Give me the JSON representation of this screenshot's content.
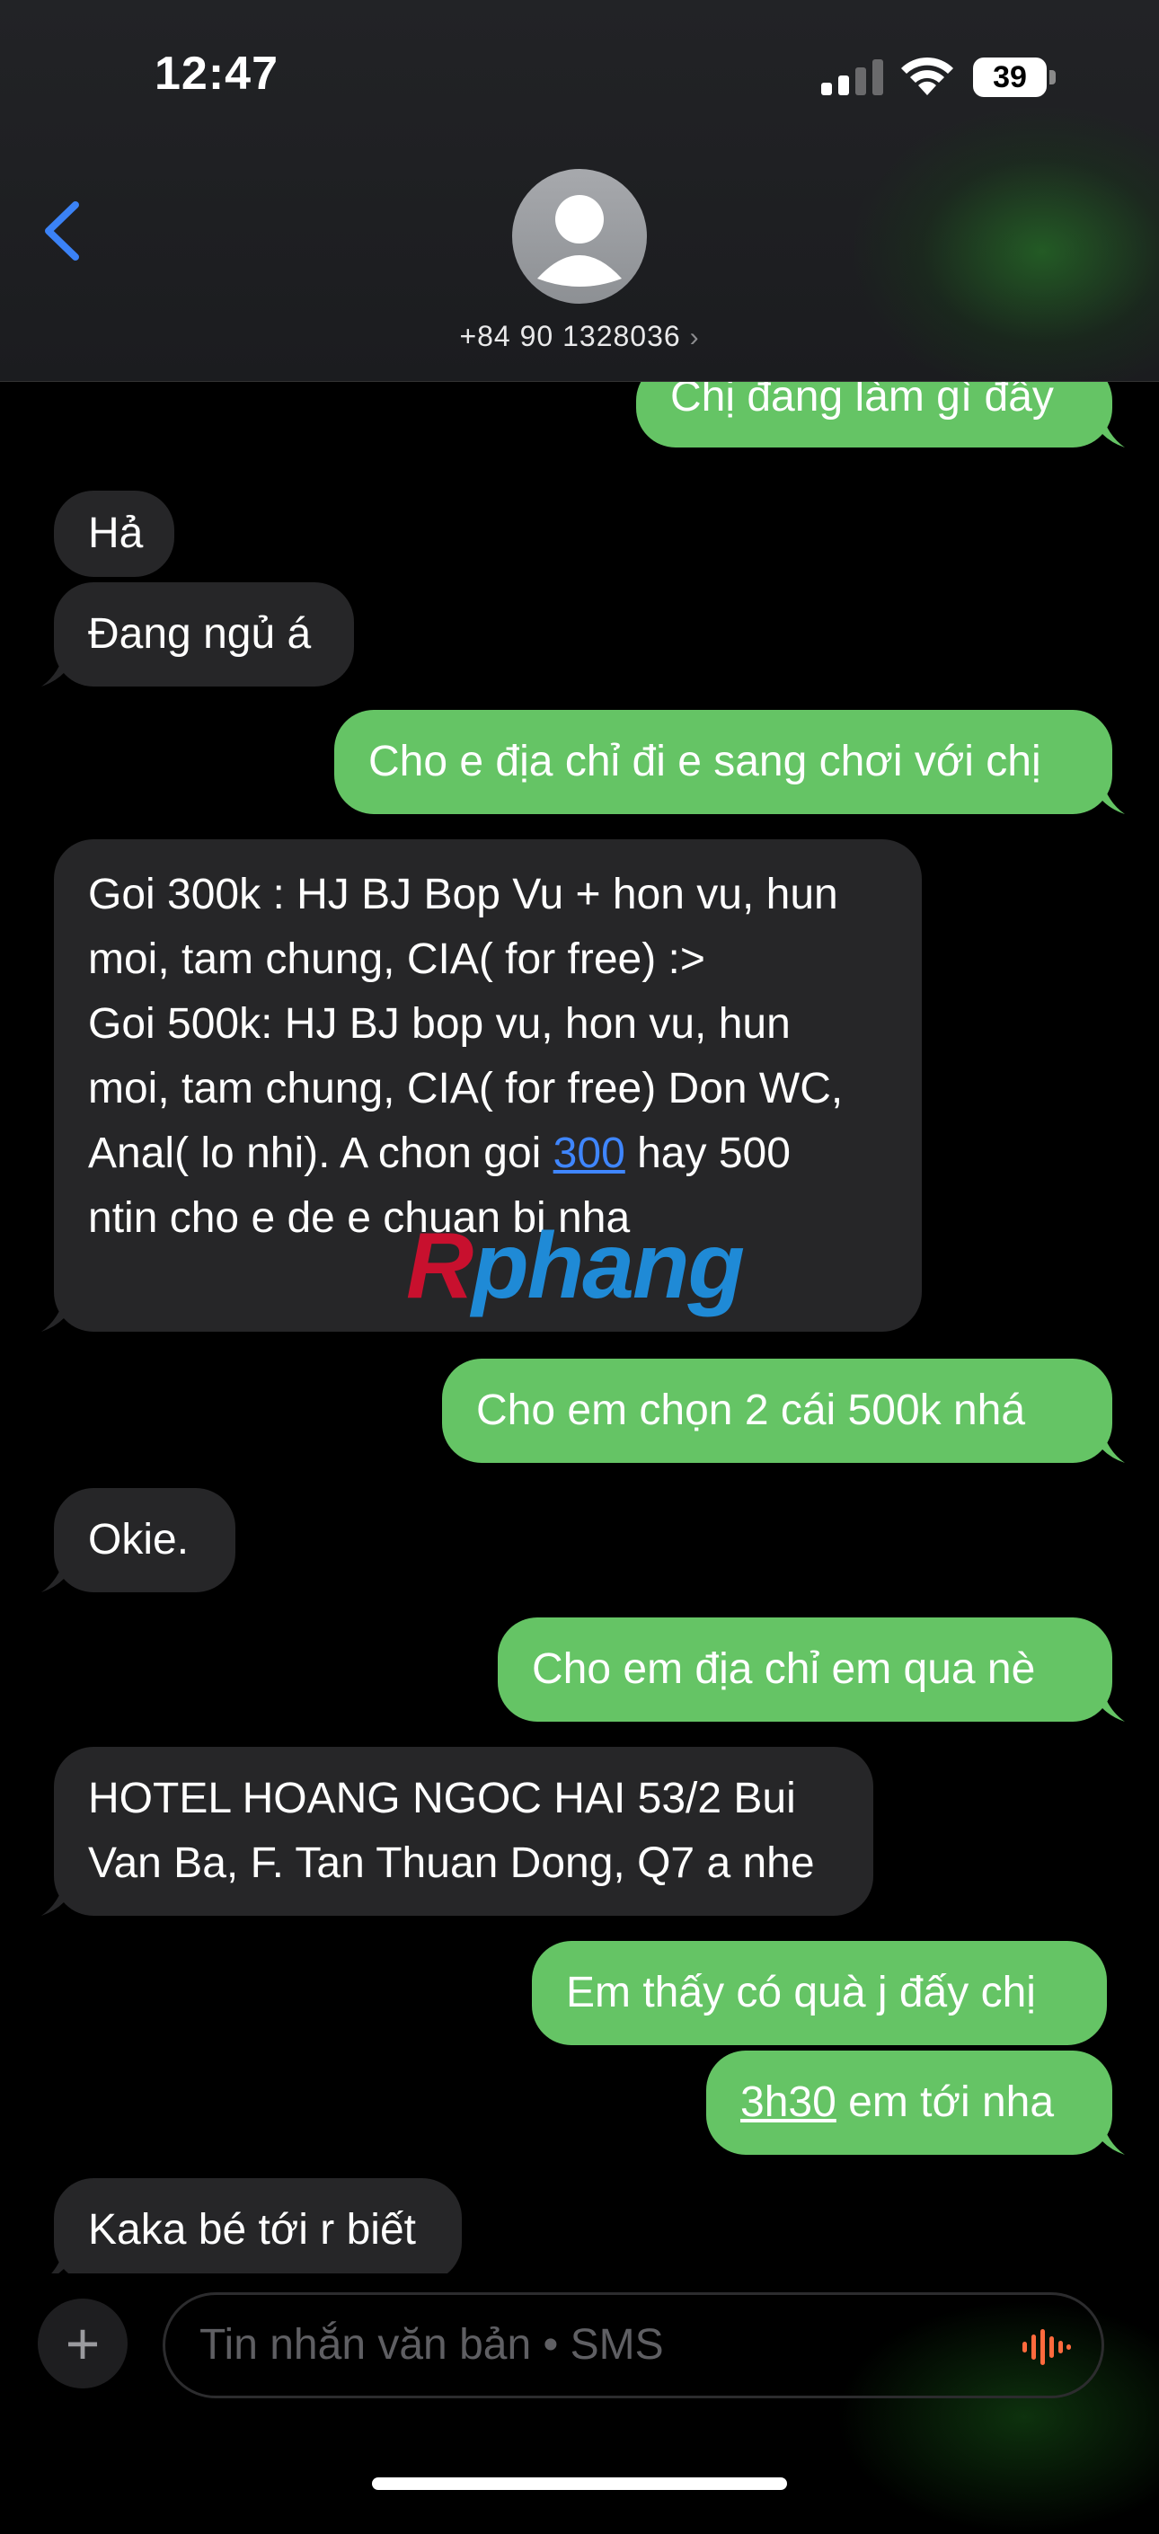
{
  "status_bar": {
    "time": "12:47",
    "battery": "39"
  },
  "header": {
    "contact": "+84 90 1328036",
    "chevron": "›"
  },
  "messages": [
    {
      "side": "sent",
      "text": "Chị đang làm gì đây"
    },
    {
      "side": "recv",
      "text": "Hả"
    },
    {
      "side": "recv",
      "text": "Đang ngủ á"
    },
    {
      "side": "sent",
      "text": "Cho e địa chỉ đi e sang chơi với chị"
    },
    {
      "side": "recv",
      "lines": [
        "Goi 300k : HJ BJ Bop Vu + hon vu, hun",
        "moi, tam chung, CIA( for free) :>",
        "Goi 500k: HJ BJ bop vu, hon vu, hun",
        "moi, tam chung, CIA( for free) Don WC,",
        "ntin cho e de e chuan bi nha"
      ],
      "line5_pre": "Anal( lo nhi). A chon goi ",
      "line5_link": "300",
      "line5_post": " hay 500"
    },
    {
      "side": "sent",
      "text": "Cho em chọn 2 cái 500k nhá"
    },
    {
      "side": "recv",
      "text": "Okie."
    },
    {
      "side": "sent",
      "text": "Cho em địa chỉ em qua nè"
    },
    {
      "side": "recv",
      "lines": [
        "HOTEL HOANG NGOC HAI 53/2 Bui",
        "Van Ba, F. Tan Thuan Dong, Q7 a nhe"
      ]
    },
    {
      "side": "sent",
      "text": "Em thấy có quà j đấy chị"
    },
    {
      "side": "sent",
      "link": "3h30",
      "text": " em tới nha"
    },
    {
      "side": "recv",
      "text": "Kaka bé tới r biết"
    }
  ],
  "watermark": {
    "part1": "R",
    "part2": "phang"
  },
  "composer": {
    "placeholder": "Tin nhắn văn bản • SMS",
    "plus": "+"
  },
  "colors": {
    "sent_bubble": "#65c465",
    "recv_bubble": "#262628",
    "link": "#3f86ff",
    "back_chevron": "#3b82f6"
  }
}
